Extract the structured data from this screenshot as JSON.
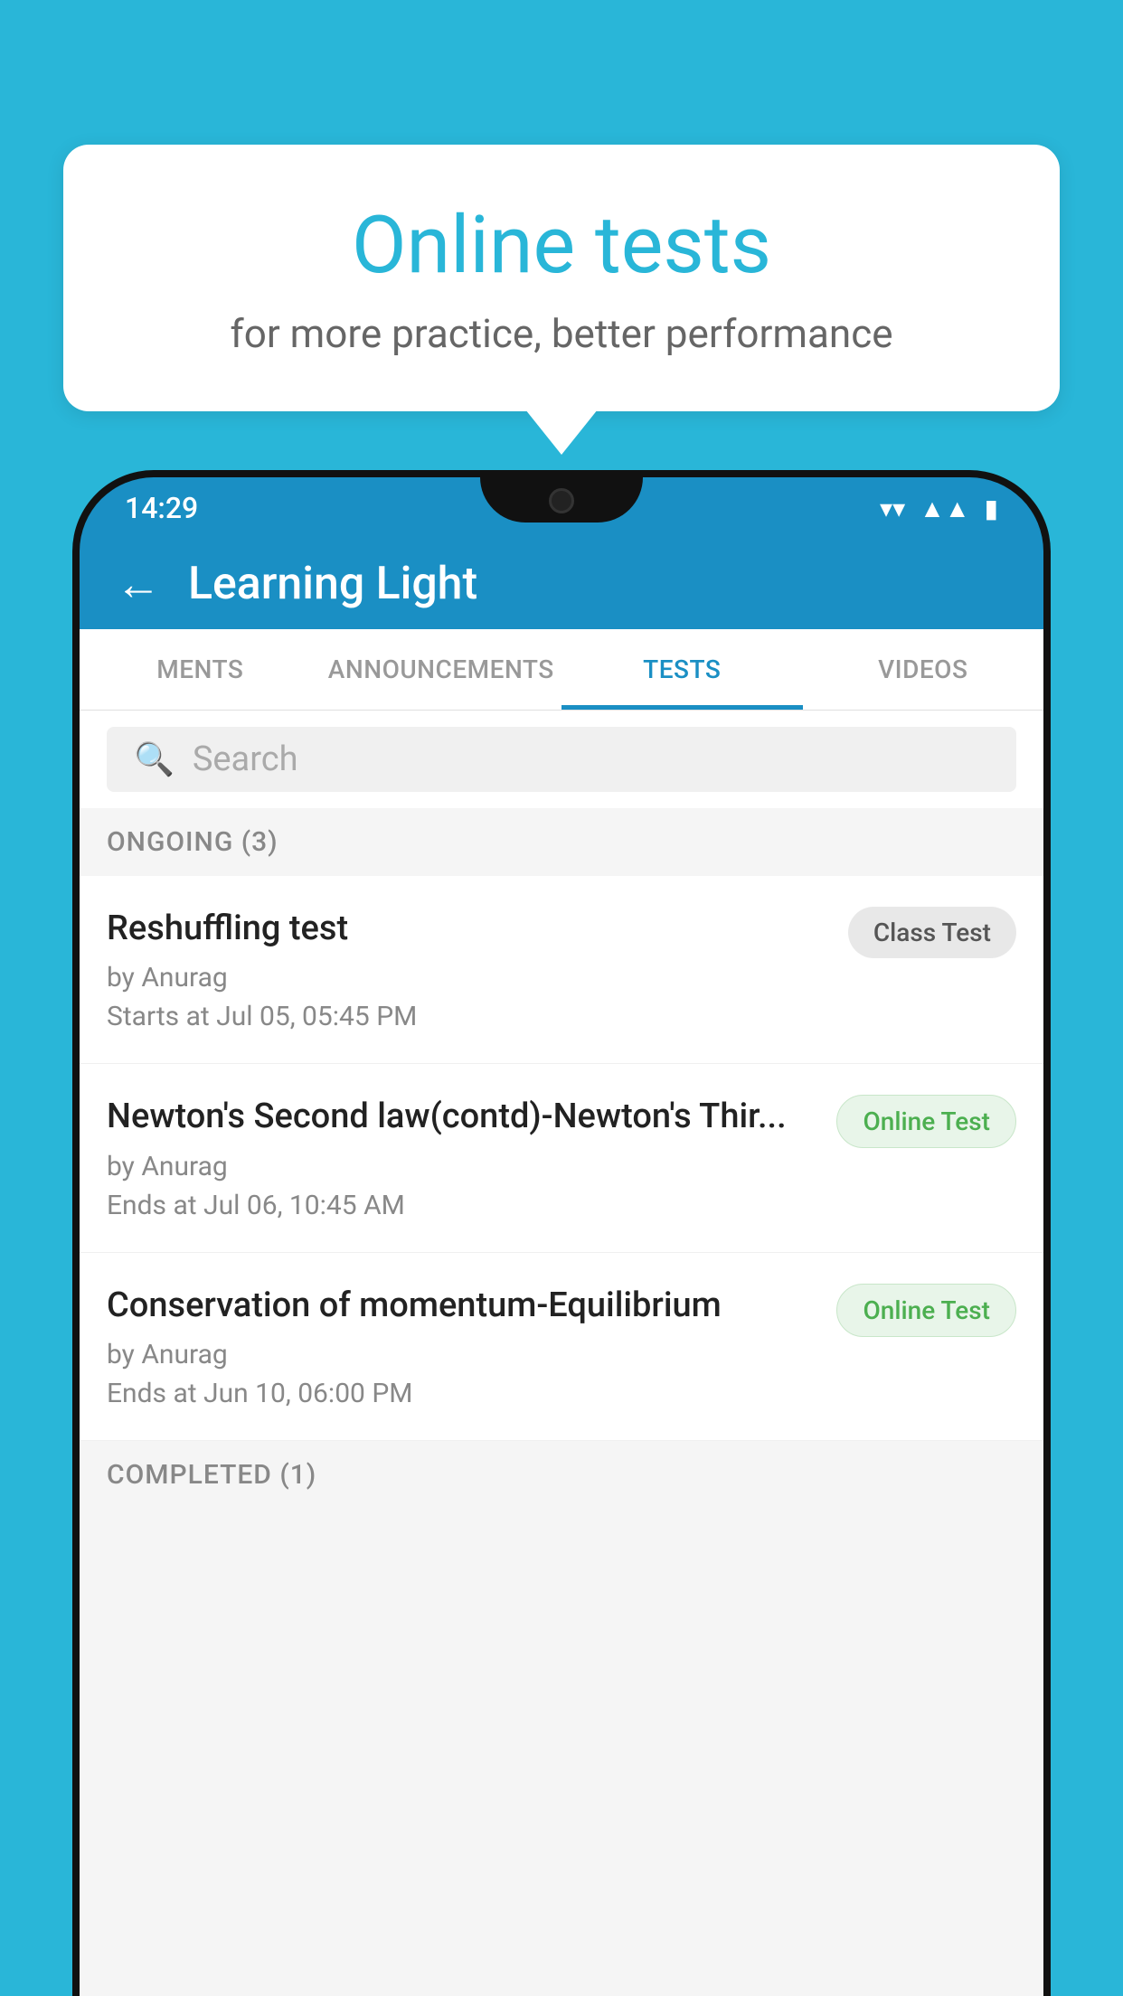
{
  "background_color": "#29b6d8",
  "bubble": {
    "title": "Online tests",
    "subtitle": "for more practice, better performance"
  },
  "phone": {
    "status_bar": {
      "time": "14:29",
      "icons": [
        "wifi",
        "signal",
        "battery"
      ]
    },
    "header": {
      "back_label": "←",
      "title": "Learning Light"
    },
    "tabs": [
      {
        "label": "MENTS",
        "active": false
      },
      {
        "label": "ANNOUNCEMENTS",
        "active": false
      },
      {
        "label": "TESTS",
        "active": true
      },
      {
        "label": "VIDEOS",
        "active": false
      }
    ],
    "search": {
      "placeholder": "Search"
    },
    "ongoing_section": {
      "label": "ONGOING (3)"
    },
    "tests": [
      {
        "name": "Reshuffling test",
        "author": "by Anurag",
        "time": "Starts at  Jul 05, 05:45 PM",
        "badge": "Class Test",
        "badge_type": "class"
      },
      {
        "name": "Newton's Second law(contd)-Newton's Thir...",
        "author": "by Anurag",
        "time": "Ends at  Jul 06, 10:45 AM",
        "badge": "Online Test",
        "badge_type": "online"
      },
      {
        "name": "Conservation of momentum-Equilibrium",
        "author": "by Anurag",
        "time": "Ends at  Jun 10, 06:00 PM",
        "badge": "Online Test",
        "badge_type": "online"
      }
    ],
    "completed_section": {
      "label": "COMPLETED (1)"
    }
  }
}
